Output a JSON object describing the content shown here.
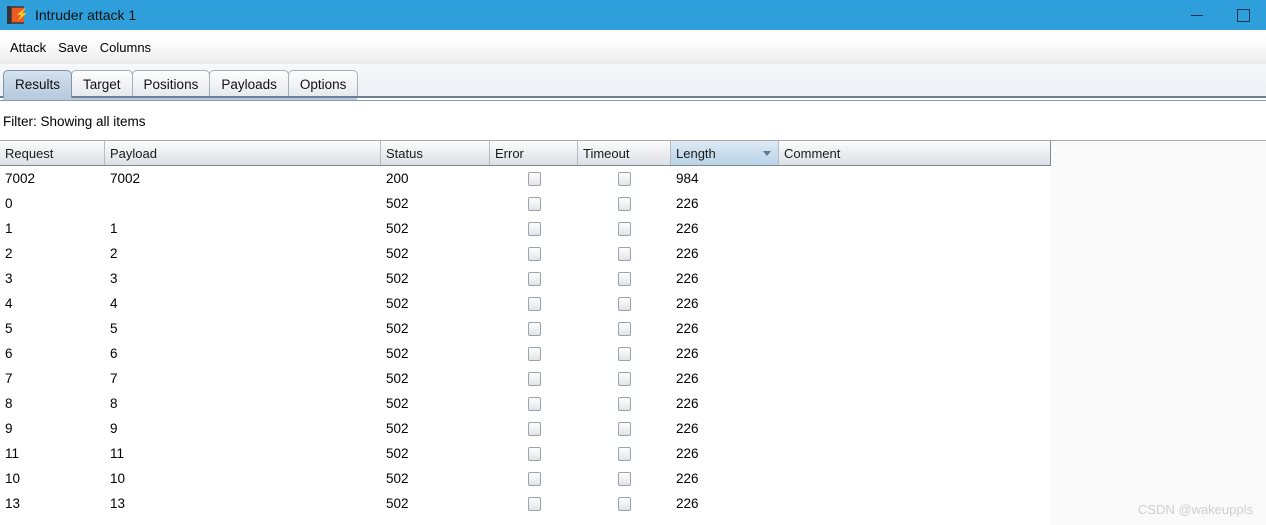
{
  "window": {
    "title": "Intruder attack 1",
    "icon": "burp-suite-icon",
    "bolt_glyph": "⚡",
    "titlebar_color": "#2f9fdb",
    "minimize_label": "Minimize",
    "maximize_label": "Maximize"
  },
  "menubar": {
    "items": [
      {
        "label": "Attack"
      },
      {
        "label": "Save"
      },
      {
        "label": "Columns"
      }
    ]
  },
  "tabs": [
    {
      "label": "Results",
      "selected": true
    },
    {
      "label": "Target",
      "selected": false
    },
    {
      "label": "Positions",
      "selected": false
    },
    {
      "label": "Payloads",
      "selected": false
    },
    {
      "label": "Options",
      "selected": false
    }
  ],
  "filter": {
    "text": "Filter: Showing all items"
  },
  "table": {
    "columns": [
      {
        "key": "request",
        "label": "Request",
        "sorted": false
      },
      {
        "key": "payload",
        "label": "Payload",
        "sorted": false
      },
      {
        "key": "status",
        "label": "Status",
        "sorted": false
      },
      {
        "key": "error",
        "label": "Error",
        "sorted": false
      },
      {
        "key": "timeout",
        "label": "Timeout",
        "sorted": false
      },
      {
        "key": "length",
        "label": "Length",
        "sorted": true,
        "sort_direction": "desc"
      },
      {
        "key": "comment",
        "label": "Comment",
        "sorted": false
      }
    ],
    "rows": [
      {
        "request": "7002",
        "payload": "7002",
        "status": "200",
        "error": false,
        "timeout": false,
        "length": "984",
        "comment": ""
      },
      {
        "request": "0",
        "payload": "",
        "status": "502",
        "error": false,
        "timeout": false,
        "length": "226",
        "comment": ""
      },
      {
        "request": "1",
        "payload": "1",
        "status": "502",
        "error": false,
        "timeout": false,
        "length": "226",
        "comment": ""
      },
      {
        "request": "2",
        "payload": "2",
        "status": "502",
        "error": false,
        "timeout": false,
        "length": "226",
        "comment": ""
      },
      {
        "request": "3",
        "payload": "3",
        "status": "502",
        "error": false,
        "timeout": false,
        "length": "226",
        "comment": ""
      },
      {
        "request": "4",
        "payload": "4",
        "status": "502",
        "error": false,
        "timeout": false,
        "length": "226",
        "comment": ""
      },
      {
        "request": "5",
        "payload": "5",
        "status": "502",
        "error": false,
        "timeout": false,
        "length": "226",
        "comment": ""
      },
      {
        "request": "6",
        "payload": "6",
        "status": "502",
        "error": false,
        "timeout": false,
        "length": "226",
        "comment": ""
      },
      {
        "request": "7",
        "payload": "7",
        "status": "502",
        "error": false,
        "timeout": false,
        "length": "226",
        "comment": ""
      },
      {
        "request": "8",
        "payload": "8",
        "status": "502",
        "error": false,
        "timeout": false,
        "length": "226",
        "comment": ""
      },
      {
        "request": "9",
        "payload": "9",
        "status": "502",
        "error": false,
        "timeout": false,
        "length": "226",
        "comment": ""
      },
      {
        "request": "11",
        "payload": "11",
        "status": "502",
        "error": false,
        "timeout": false,
        "length": "226",
        "comment": ""
      },
      {
        "request": "10",
        "payload": "10",
        "status": "502",
        "error": false,
        "timeout": false,
        "length": "226",
        "comment": ""
      },
      {
        "request": "13",
        "payload": "13",
        "status": "502",
        "error": false,
        "timeout": false,
        "length": "226",
        "comment": ""
      }
    ]
  },
  "watermark": {
    "text": "CSDN @wakeuppls"
  }
}
